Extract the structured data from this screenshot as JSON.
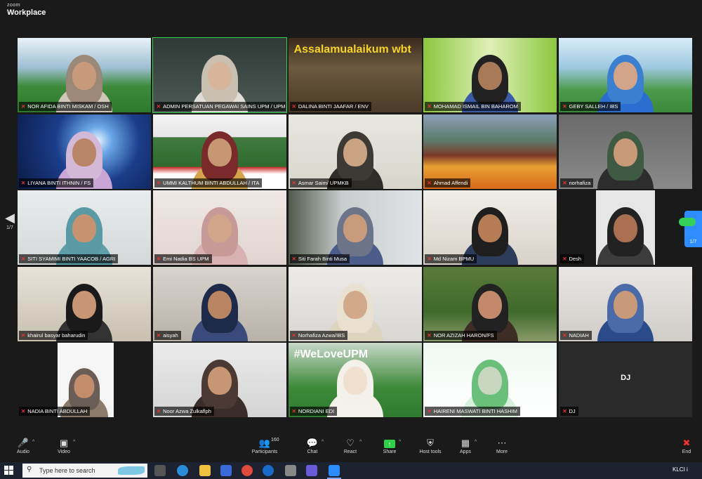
{
  "app": {
    "brand_top": "zoom",
    "brand_main": "Workplace"
  },
  "gallery": {
    "page_left": "1/7",
    "page_right": "1/7",
    "tiles": [
      {
        "name": "NOR AFIDA BINTI MISKAM / OSH",
        "bg": "linear-gradient(180deg,#e8f1f7 0%,#9fbfd3 40%,#3c8a3a 65%,#2d7a2c 100%)",
        "skin": "#c89a7a",
        "hijab": "#9b8878",
        "body": "#cfc8b8"
      },
      {
        "name": "ADMIN PERSATUAN PEGAWAI SAINS UPM / UPM",
        "bg": "linear-gradient(180deg,#2f3a37 0%,#4c5a55 100%)",
        "skin": "#d7b59a",
        "hijab": "#c9c0b2",
        "body": "#e0ddd8",
        "active": true
      },
      {
        "name": "DALINA BINTI JAAFAR / ENV",
        "bg": "linear-gradient(180deg,#3b2a1e 0%,#6b5a3e 40%,#4a3a28 100%)",
        "banner": "Assalamualaikum wbt",
        "banner_color": "#f5d32a",
        "no_person": true
      },
      {
        "name": "MOHAMAD ISMAIL BIN BAHAROM",
        "bg": "linear-gradient(90deg,#8cc63f 0%,#dff0b8 50%,#8cc63f 100%)",
        "skin": "#a87a58",
        "hijab": "#222",
        "body": "#3b5aa8"
      },
      {
        "name": "GEBY SALLEH / IBS",
        "bg": "linear-gradient(180deg,#d9ecf7 0%,#9dc8e0 40%,#4c9a4c 70%,#3a8a3a 100%)",
        "skin": "#d2a48a",
        "hijab": "#3a7fd0",
        "body": "#2c6ed0"
      },
      {
        "name": "LIYANA BINTI ITHNIN / FS",
        "bg": "radial-gradient(circle at 60% 35%,#e8f4ff 0%,#6aa7e8 15%,#1b3d8a 45%,#0b1a45 100%)",
        "skin": "#b88566",
        "hijab": "#d4b8d8",
        "body": "#c9a6d6"
      },
      {
        "name": "UMMI KALTHUM BINTI ABDULLAH / ITA",
        "bg": "linear-gradient(180deg,#f5f5f5 0%,#e6e6e6 30%,#3f7a3f 31%,#2f6a2f 70%,#c33 71%,#fff 80%)",
        "skin": "#c79774",
        "hijab": "#7a2a2a",
        "body": "#d4a44a"
      },
      {
        "name": "Asmar Saim/ UPMKB",
        "bg": "linear-gradient(180deg,#e7e7e0 0%,#d8d6cc 100%)",
        "skin": "#caa383",
        "hijab": "#3d3a35",
        "body": "#2f2d2a"
      },
      {
        "name": "Ahmad Affendi",
        "bg": "linear-gradient(180deg,#8aa0b8 0%,#5d7a6a 35%,#7a3a2a 55%,#e8a033 70%,#d86a1a 100%)",
        "no_person": true
      },
      {
        "name": "norhafiza",
        "bg": "linear-gradient(180deg,#6a6a6a 0%,#8a8a8a 100%)",
        "skin": "#c99a78",
        "hijab": "#3f5a42",
        "body": "#2d2d2d"
      },
      {
        "name": "SITI SYAMIMI BINTI YAACOB / AGRI",
        "bg": "linear-gradient(180deg,#e9ecec 0%,#d4d8d8 100%)",
        "skin": "#c69270",
        "hijab": "#5a9aa5",
        "body": "#5f9fa8"
      },
      {
        "name": "Emi Nadia BS UPM",
        "bg": "linear-gradient(180deg,#efe8e4 0%,#e0d4cf 100%)",
        "skin": "#d2a58a",
        "hijab": "#c79a98",
        "body": "#d8b2b0"
      },
      {
        "name": "Siti Farah Binti Musa",
        "bg": "linear-gradient(90deg,#4f5a4a 0%,#c8cccc 40%,#e0e4e6 100%)",
        "skin": "#c79b7c",
        "hijab": "#6c748a",
        "body": "#4a5d8a"
      },
      {
        "name": "Md Nizam BPMU",
        "bg": "linear-gradient(180deg,#f0eee9 0%,#d8d2c8 100%)",
        "skin": "#b57c56",
        "hijab": "#1e1e1e",
        "body": "#2d3c5a"
      },
      {
        "name": "Desh",
        "bg": "linear-gradient(90deg,#1a1a1a 0%,#1a1a1a 28%,#e6e6e6 28%,#e6e6e6 72%,#1a1a1a 72%)",
        "skin": "#a87050",
        "hijab": "#222",
        "body": "#3c3c3c"
      },
      {
        "name": "khairul basyar baharudin",
        "bg": "linear-gradient(180deg,#e8e2d8 0%,#c8c0b0 100%)",
        "skin": "#c79674",
        "hijab": "#1a1a1a",
        "body": "#333"
      },
      {
        "name": "aisyah",
        "bg": "linear-gradient(180deg,#d8d4ce 0%,#b8b2a8 100%)",
        "skin": "#b88462",
        "hijab": "#1d2a4a",
        "body": "#3a4a7a"
      },
      {
        "name": "Norhafiza Azwa/IBS",
        "bg": "linear-gradient(180deg,#ecebe8 0%,#d8d6d2 100%)",
        "skin": "#d2a88a",
        "hijab": "#e8e0d0",
        "body": "#ddd4c0"
      },
      {
        "name": "NOR AZIZAH HARON/FS",
        "bg": "linear-gradient(180deg,#5a7a3a 0%,#3e6a2a 60%,#8a9a6a 100%)",
        "skin": "#c28a6a",
        "hijab": "#222",
        "body": "#3d2d25"
      },
      {
        "name": "NADIAH",
        "bg": "linear-gradient(180deg,#e8e6e4 0%,#d0ccc8 100%)",
        "skin": "#c89a7a",
        "hijab": "#4a6aa8",
        "body": "#2a4a8a"
      },
      {
        "name": "NADIA BINTI ABDULLAH",
        "bg": "linear-gradient(90deg,#1a1a1a 0%,#1a1a1a 30%,#f5f5f5 30%,#f5f5f5 72%,#1a1a1a 72%)",
        "skin": "#c38c6a",
        "hijab": "#6a5d55",
        "body": "#8a7a6a",
        "small": true
      },
      {
        "name": "Noor Azwa Zulkaflph",
        "bg": "linear-gradient(180deg,#eaeaea 0%,#d4d4d4 100%)",
        "skin": "#c79674",
        "hijab": "#4a3a33",
        "body": "#3a2d2a"
      },
      {
        "name": "NORDIANI EDI",
        "bg": "linear-gradient(180deg,#c7d8c8 0%,#3e8a3a 60%,#2f7a2f 100%)",
        "banner": "#WeLoveUPM",
        "banner_color": "#fff",
        "skin": "#f0e0d0",
        "hijab": "#f4f0ea",
        "body": "#f5f2ee"
      },
      {
        "name": "HAIRENI MASWATI BINTI HASHIM",
        "bg": "linear-gradient(180deg,#eef8f2 0%,#ffffff 100%)",
        "skin": "#c8d8c0",
        "hijab": "#6ac07a",
        "body": "#d8f0de"
      },
      {
        "name": "DJ",
        "bg": "#2a2a2a",
        "no_person": true,
        "dj": "DJ"
      }
    ]
  },
  "controls": {
    "audio": "Audio",
    "video": "Video",
    "participants": "Participants",
    "participants_count": "160",
    "chat": "Chat",
    "react": "React",
    "share": "Share",
    "host_tools": "Host tools",
    "apps": "Apps",
    "more": "More",
    "end": "End"
  },
  "taskbar": {
    "search_placeholder": "Type here to search",
    "tray_text": "KLCI i"
  }
}
